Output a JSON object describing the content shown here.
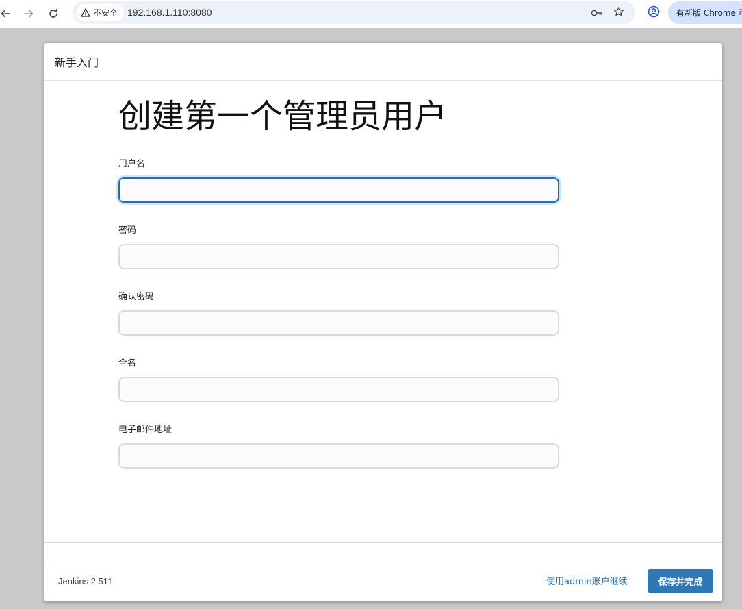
{
  "browser": {
    "security_label": "不安全",
    "url": "192.168.1.110:8080",
    "update_label": "有新版 Chrome 可"
  },
  "dialog": {
    "header_title": "新手入门",
    "page_title": "创建第一个管理员用户",
    "fields": [
      {
        "label": "用户名",
        "value": ""
      },
      {
        "label": "密码",
        "value": ""
      },
      {
        "label": "确认密码",
        "value": ""
      },
      {
        "label": "全名",
        "value": ""
      },
      {
        "label": "电子邮件地址",
        "value": ""
      }
    ],
    "footer": {
      "version": "Jenkins 2.511",
      "continue_admin_label": "使用admin账户继续",
      "save_label": "保存并完成"
    }
  },
  "colors": {
    "primary_button": "#2f77b5",
    "link": "#2f6ea8",
    "focus_border": "#1c6fc4"
  }
}
